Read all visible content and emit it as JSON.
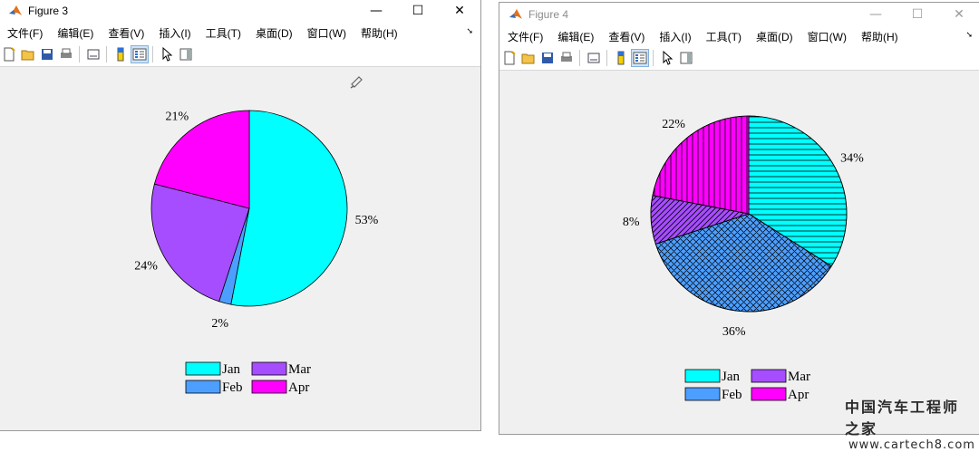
{
  "colors": {
    "jan": "#00ffff",
    "feb": "#4d9fff",
    "mar": "#a64dff",
    "apr": "#ff00ff"
  },
  "windows": [
    {
      "title": "Figure 3",
      "controls": {
        "minimize": "—",
        "maximize": "☐",
        "close": "✕"
      },
      "menu": [
        "文件(F)",
        "编辑(E)",
        "查看(V)",
        "插入(I)",
        "工具(T)",
        "桌面(D)",
        "窗口(W)",
        "帮助(H)"
      ],
      "menu_overflow": "➘"
    },
    {
      "title": "Figure 4",
      "controls": {
        "minimize": "—",
        "maximize": "☐",
        "close": "✕"
      },
      "menu": [
        "文件(F)",
        "编辑(E)",
        "查看(V)",
        "插入(I)",
        "工具(T)",
        "桌面(D)",
        "窗口(W)",
        "帮助(H)"
      ],
      "menu_overflow": "➘"
    }
  ],
  "chart_data": [
    {
      "type": "pie",
      "categories": [
        "Jan",
        "Feb",
        "Mar",
        "Apr"
      ],
      "values": [
        53,
        2,
        24,
        21
      ],
      "labels": [
        "53%",
        "2%",
        "24%",
        "21%"
      ],
      "legend": {
        "placement": "bottom",
        "entries": [
          "Jan",
          "Feb",
          "Mar",
          "Apr"
        ]
      }
    },
    {
      "type": "pie",
      "categories": [
        "Jan",
        "Feb",
        "Mar",
        "Apr"
      ],
      "values": [
        34,
        36,
        8,
        22
      ],
      "labels": [
        "34%",
        "36%",
        "8%",
        "22%"
      ],
      "hatching": [
        "horizontal",
        "cross",
        "diagonal",
        "vertical"
      ],
      "legend": {
        "placement": "bottom",
        "entries": [
          "Jan",
          "Feb",
          "Mar",
          "Apr"
        ]
      }
    }
  ],
  "watermark": {
    "line1": "中国汽车工程师之家",
    "line2": "www.cartech8.com"
  }
}
